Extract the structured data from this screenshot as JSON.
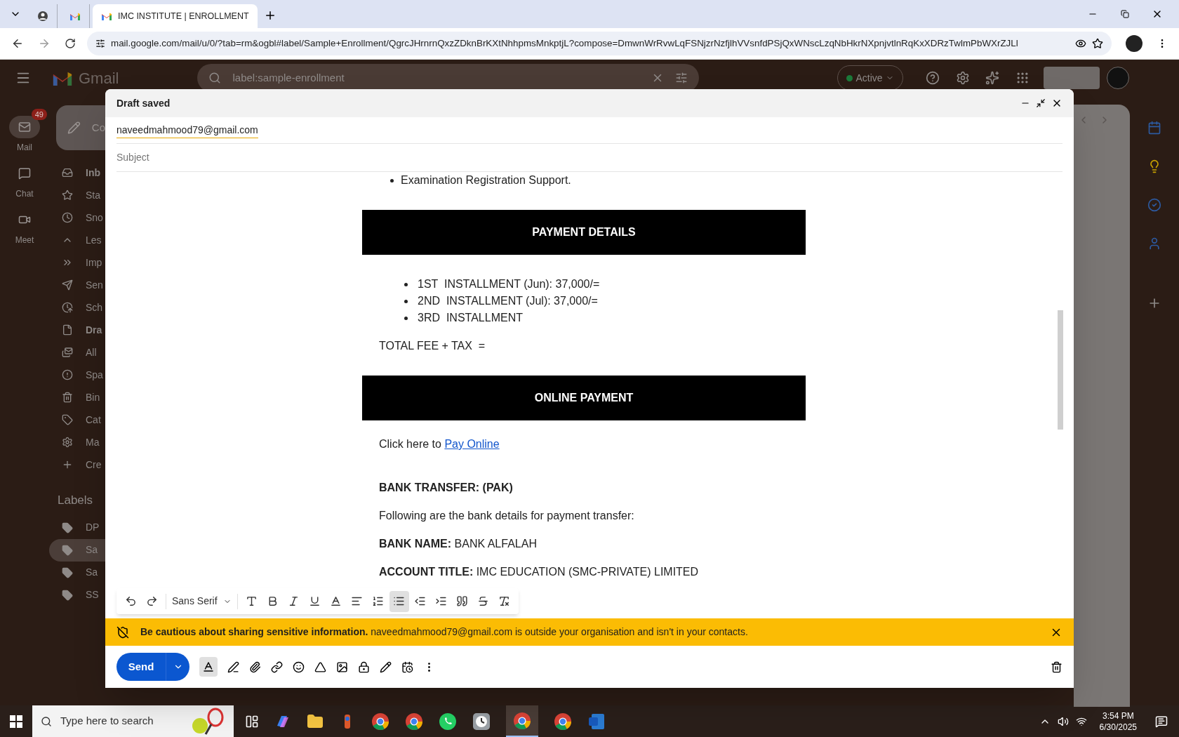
{
  "browser": {
    "tabs": [
      {
        "kind": "extension",
        "selected": false
      },
      {
        "kind": "gmail",
        "selected": false
      },
      {
        "kind": "gmail",
        "title": "IMC INSTITUTE | ENROLLMENT",
        "selected": true
      }
    ],
    "url": "mail.google.com/mail/u/0/?tab=rm&ogbl#label/Sample+Enrollment/QgrcJHrnrnQxzZDknBrKXtNhhpmsMnkptjL?compose=DmwnWrRvwLqFSNjzrNzfjlhVVsnfdPSjQxWNscLzqNbHkrNXpnjvtlnRqKxXDRzTwlmPbWXrZJLl"
  },
  "gmail": {
    "logo": "Gmail",
    "search": {
      "value": "label:sample-enrollment"
    },
    "status": "Active",
    "rail": [
      {
        "kind": "mail",
        "label": "Mail",
        "badge": "49",
        "selected": true
      },
      {
        "kind": "chat",
        "label": "Chat",
        "selected": false
      },
      {
        "kind": "meet",
        "label": "Meet",
        "selected": false
      }
    ],
    "compose_button": "Co",
    "nav": [
      {
        "kind": "inbox",
        "label": "Inb",
        "bold": true
      },
      {
        "kind": "star",
        "label": "Sta",
        "bold": false
      },
      {
        "kind": "clock",
        "label": "Sno",
        "bold": false
      },
      {
        "kind": "less",
        "label": "Les",
        "bold": false
      },
      {
        "kind": "important",
        "label": "Imp",
        "bold": false
      },
      {
        "kind": "sent",
        "label": "Sen",
        "bold": false
      },
      {
        "kind": "scheduled",
        "label": "Sch",
        "bold": false
      },
      {
        "kind": "drafts",
        "label": "Dra",
        "bold": true
      },
      {
        "kind": "all",
        "label": "All",
        "bold": false
      },
      {
        "kind": "spam",
        "label": "Spa",
        "bold": false
      },
      {
        "kind": "bin",
        "label": "Bin",
        "bold": false
      },
      {
        "kind": "categories",
        "label": "Cat",
        "bold": false
      },
      {
        "kind": "manage",
        "label": "Ma",
        "bold": false
      },
      {
        "kind": "create",
        "label": "Cre",
        "bold": false
      }
    ],
    "labels_heading": "Labels",
    "labels": [
      {
        "label": "DP",
        "selected": false
      },
      {
        "label": "Sa",
        "selected": true
      },
      {
        "label": "Sa",
        "selected": false
      },
      {
        "label": "SS",
        "selected": false
      }
    ]
  },
  "compose": {
    "title": "Draft saved",
    "to": "naveedmahmood79@gmail.com",
    "subject": {
      "placeholder": "Subject"
    },
    "body": [
      {
        "kind": "bullet",
        "text": "Examination Registration Support."
      },
      {
        "kind": "banner",
        "text": "PAYMENT DETAILS"
      },
      {
        "kind": "bullets",
        "items": [
          "1ST  INSTALLMENT (Jun): 37,000/=",
          "2ND  INSTALLMENT (Jul): 37,000/=",
          "3RD  INSTALLMENT"
        ]
      },
      {
        "kind": "paragraph",
        "text": "TOTAL FEE + TAX  ="
      },
      {
        "kind": "banner",
        "text": "ONLINE PAYMENT"
      },
      {
        "kind": "link",
        "text": "Click here to ",
        "link": "Pay Online"
      },
      {
        "kind": "heading",
        "text": "BANK TRANSFER: (PAK)"
      },
      {
        "kind": "paragraph",
        "text": "Following are the bank details for payment transfer:"
      },
      {
        "kind": "paragraph",
        "text": "**BANK NAME:** BANK ALFALAH"
      },
      {
        "kind": "paragraph",
        "text": "**ACCOUNT TITLE:** IMC EDUCATION (SMC-PRIVATE) LIMITED"
      }
    ],
    "font": "Sans Serif",
    "tools": [
      {
        "kind": "undo",
        "selected": false
      },
      {
        "kind": "redo",
        "selected": false
      },
      {
        "kind": "font"
      },
      {
        "kind": "size",
        "selected": false
      },
      {
        "kind": "bold",
        "selected": false
      },
      {
        "kind": "italic",
        "selected": false
      },
      {
        "kind": "underline",
        "selected": false
      },
      {
        "kind": "color",
        "selected": false
      },
      {
        "kind": "align",
        "selected": false
      },
      {
        "kind": "numbered",
        "selected": false
      },
      {
        "kind": "bulleted",
        "selected": true
      },
      {
        "kind": "outdent",
        "selected": false
      },
      {
        "kind": "indent",
        "selected": false
      },
      {
        "kind": "quote",
        "selected": false
      },
      {
        "kind": "strike",
        "selected": false
      },
      {
        "kind": "clear",
        "selected": false
      }
    ],
    "warning": {
      "bold": "Be cautious about sharing sensitive information.",
      "text": "naveedmahmood79@gmail.com is outside your organisation and isn't in your contacts."
    },
    "send": "Send"
  },
  "taskbar": {
    "search": {
      "placeholder": "Type here to search"
    },
    "time": "3:54 PM",
    "date": "6/30/2025"
  }
}
